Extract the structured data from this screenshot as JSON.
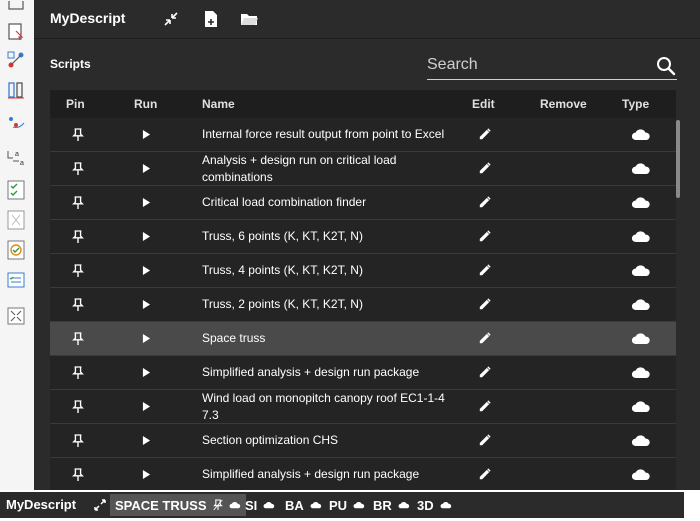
{
  "app": {
    "title": "MyDescript",
    "icons": [
      "collapse-icon",
      "new-script-icon",
      "open-folder-icon"
    ]
  },
  "toolbar_left": {
    "icons": [
      "cursor-doc-icon",
      "nodes-move-icon",
      "columns-icon",
      "points-icon",
      "a-arrows-icon",
      "check-list-icon",
      "grid-icon",
      "check-orange-icon",
      "list-check-icon",
      "fit-view-icon"
    ]
  },
  "scripts": {
    "label": "Scripts",
    "search_placeholder": "Search",
    "columns": {
      "pin": "Pin",
      "run": "Run",
      "name": "Name",
      "edit": "Edit",
      "remove": "Remove",
      "type": "Type"
    },
    "rows": [
      {
        "name": "Internal force result output from point to Excel",
        "type_icon": "cloud-icon"
      },
      {
        "name": "Analysis + design run on critical load combinations",
        "type_icon": "cloud-icon"
      },
      {
        "name": "Critical load combination finder",
        "type_icon": "cloud-icon"
      },
      {
        "name": "Truss, 6 points (K, KT, K2T, N)",
        "type_icon": "cloud-icon"
      },
      {
        "name": "Truss, 4 points (K, KT, K2T, N)",
        "type_icon": "cloud-icon"
      },
      {
        "name": "Truss, 2 points (K, KT, K2T, N)",
        "type_icon": "cloud-icon"
      },
      {
        "name": "Space truss",
        "type_icon": "cloud-icon",
        "selected": true
      },
      {
        "name": "Simplified analysis + design run package",
        "type_icon": "cloud-icon"
      },
      {
        "name": "Wind load on monopitch canopy roof EC1-1-4 7.3",
        "type_icon": "cloud-icon"
      },
      {
        "name": "Section optimization CHS",
        "type_icon": "cloud-icon"
      },
      {
        "name": "Simplified analysis + design run package",
        "type_icon": "cloud-icon"
      }
    ]
  },
  "statusbar": {
    "title": "MyDescript",
    "tabs": [
      {
        "label": "SPACE TRUSS",
        "active": true,
        "pin_off": true
      },
      {
        "label": "SI"
      },
      {
        "label": "BA"
      },
      {
        "label": "PU"
      },
      {
        "label": "BR"
      },
      {
        "label": "3D"
      }
    ]
  },
  "colors": {
    "panel": "#2b2b2b",
    "table": "#242424",
    "header": "#1e1e1e",
    "selected_row": "#4a4a4a",
    "text": "#ffffff"
  }
}
